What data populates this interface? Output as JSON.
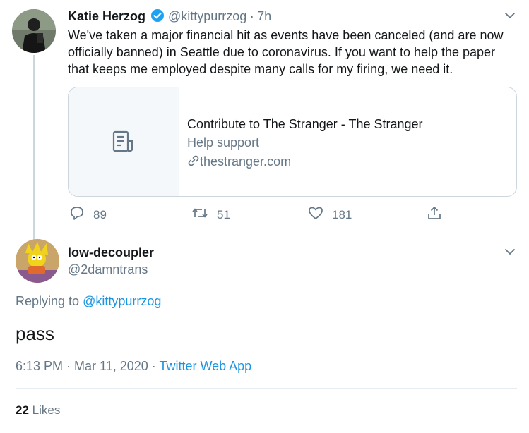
{
  "tweet": {
    "author_name": "Katie Herzog",
    "handle": "@kittypurrzog",
    "separator": "·",
    "time": "7h",
    "text_lines": [
      "We've taken a major financial hit as events have been canceled (and are now",
      "officially banned) in Seattle due to coronavirus. If you want to help the paper",
      "that keeps me employed despite many calls for my firing, we need it."
    ],
    "card": {
      "title": "Contribute to The Stranger - The Stranger",
      "description": "Help support",
      "domain": "thestranger.com"
    },
    "actions": {
      "replies": "89",
      "retweets": "51",
      "likes": "181"
    }
  },
  "reply": {
    "author_name": "low-decoupler",
    "handle": "@2damntrans",
    "replying_prefix": "Replying to",
    "replying_to": "@kittypurrzog",
    "text": "pass",
    "timestamp": "6:13 PM · Mar 11, 2020 ·",
    "source": "Twitter Web App",
    "likes_count": "22",
    "likes_label": "Likes"
  },
  "colors": {
    "accent": "#1b95e0",
    "muted": "#657786",
    "border": "#ccd6dd"
  }
}
